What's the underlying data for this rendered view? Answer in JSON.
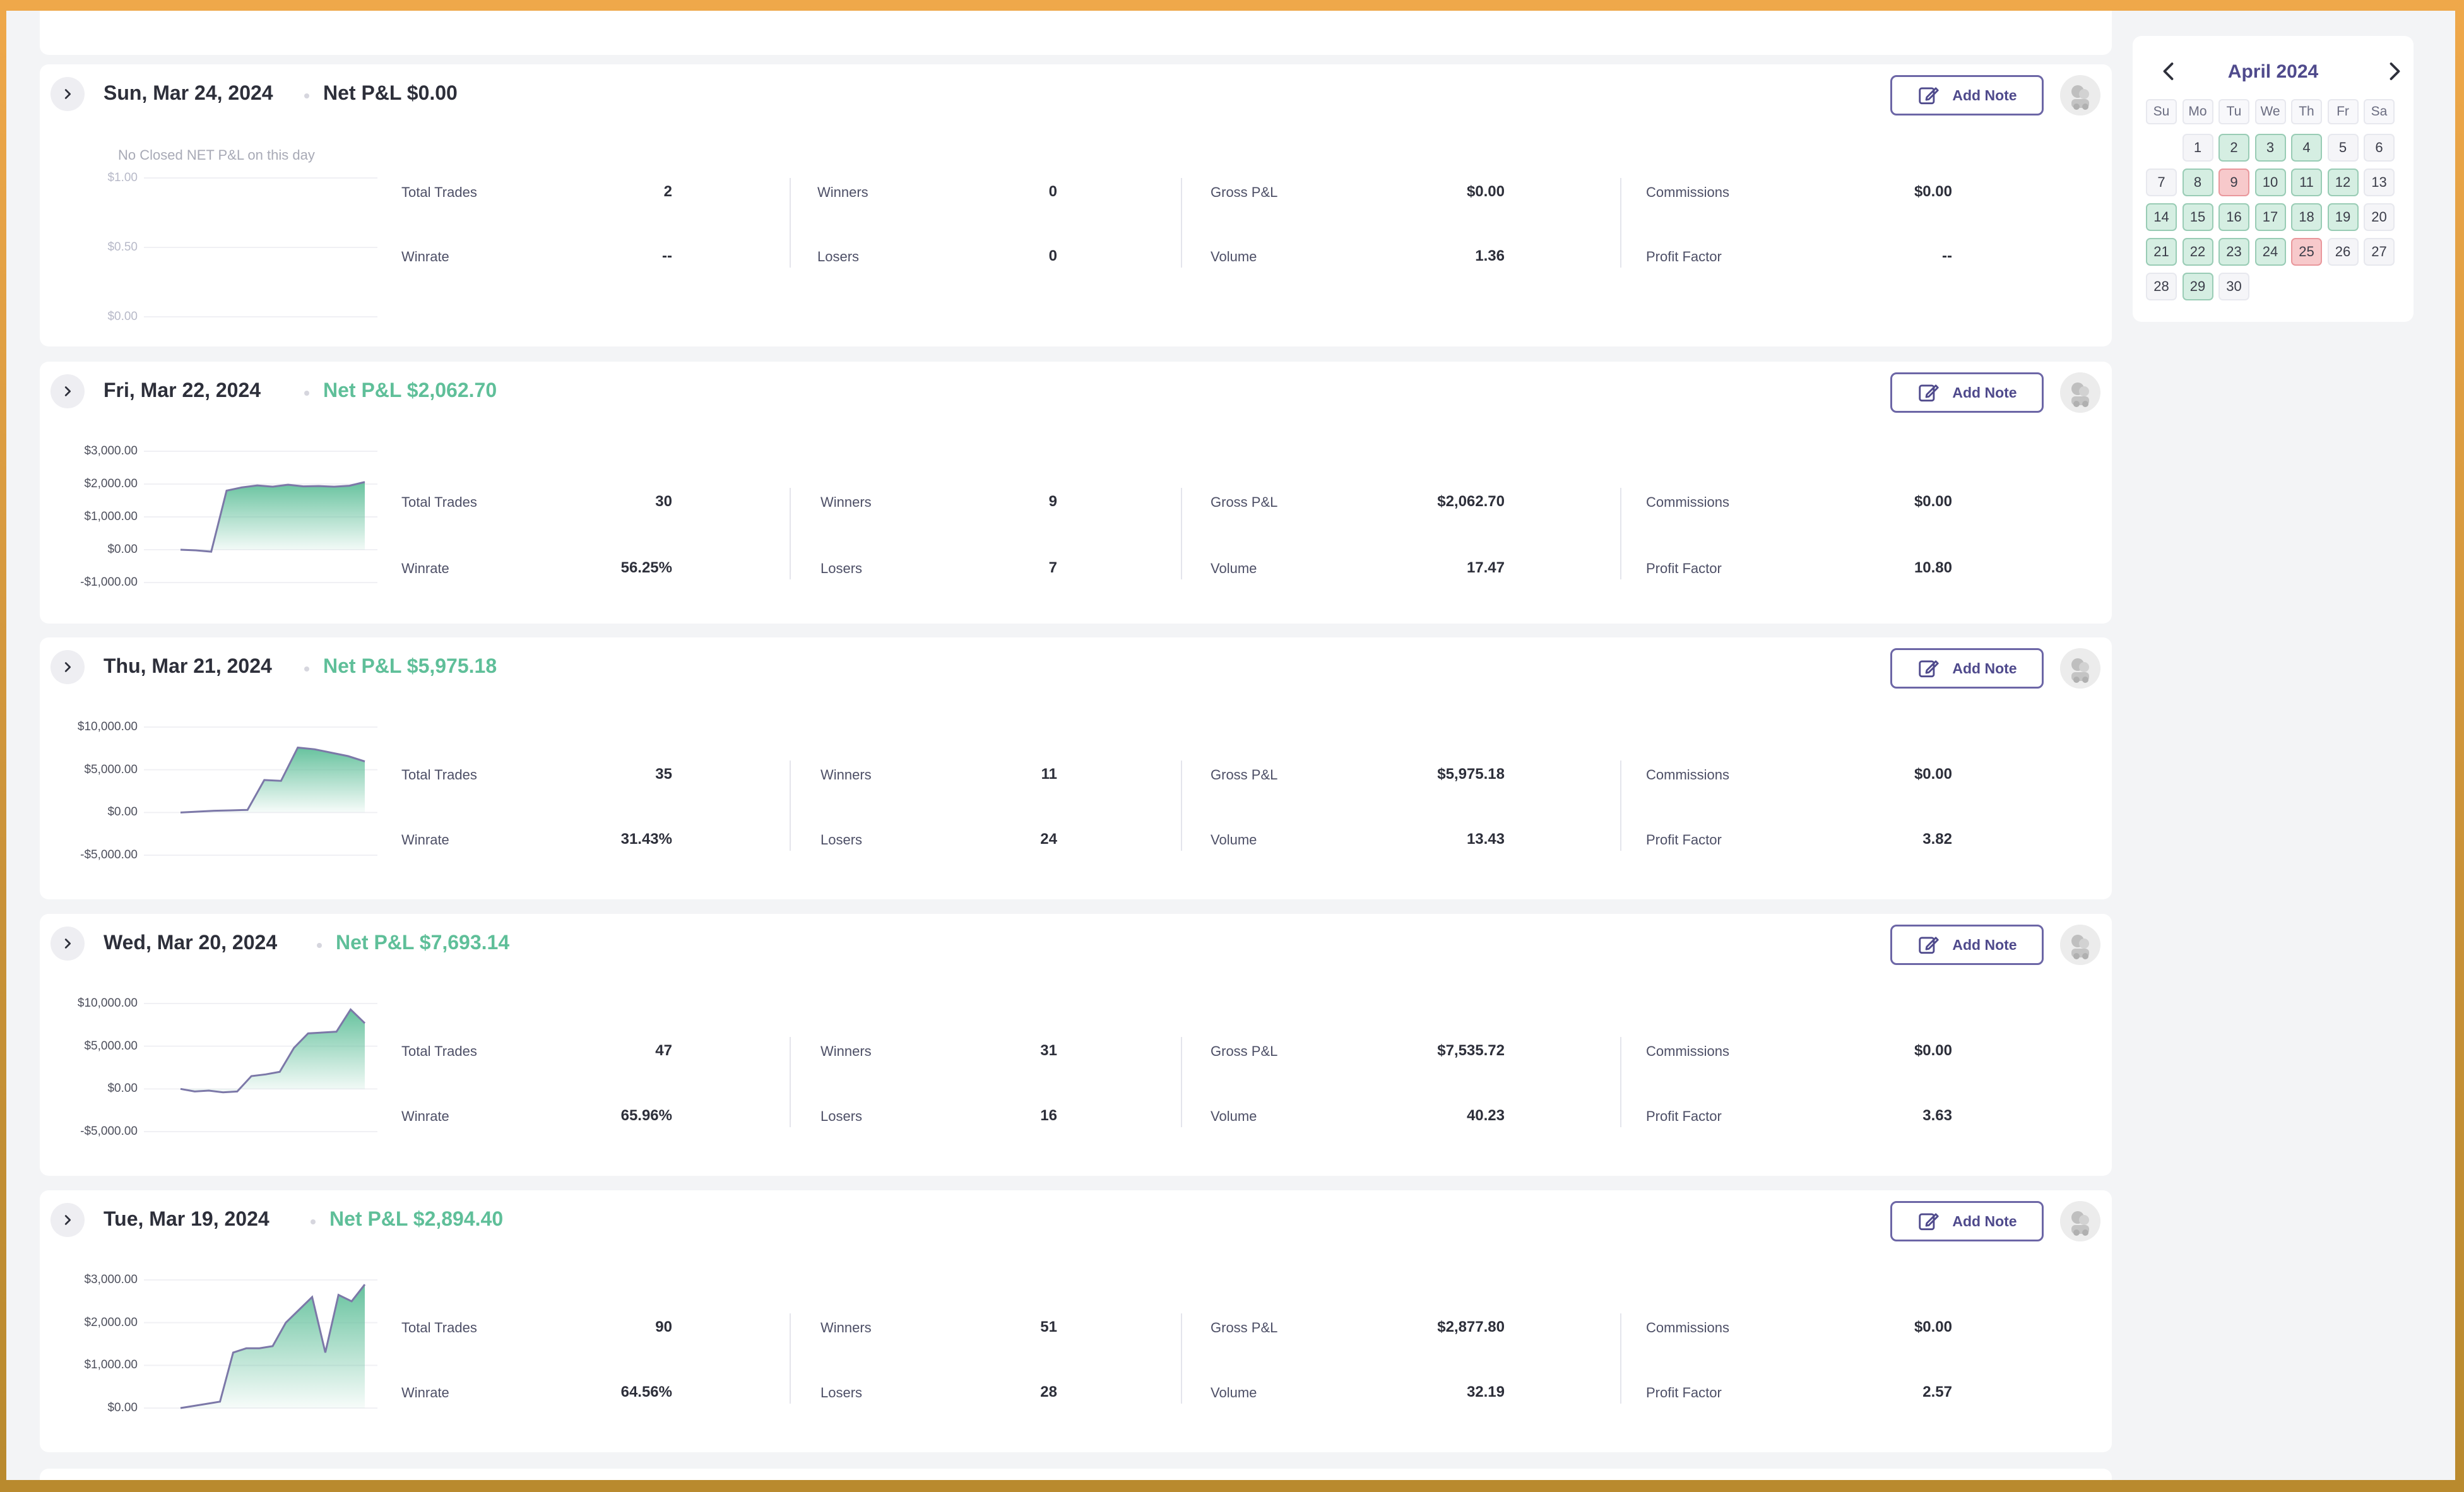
{
  "stat_labels": {
    "total_trades": "Total Trades",
    "winrate": "Winrate",
    "winners": "Winners",
    "losers": "Losers",
    "gross_pnl": "Gross P&L",
    "volume": "Volume",
    "commissions": "Commissions",
    "profit_factor": "Profit Factor"
  },
  "add_note_label": "Add Note",
  "days": [
    {
      "date": "Sun, Mar 24, 2024",
      "net_pnl": "Net P&L $0.00",
      "pnl_color": "#2d2f3a",
      "no_data_text": "No Closed NET P&L on this day",
      "chart_ticks": [
        "$1.00",
        "$0.50",
        "$0.00"
      ],
      "stats": {
        "total_trades": "2",
        "winrate": "--",
        "winners": "0",
        "losers": "0",
        "gross_pnl": "$0.00",
        "volume": "1.36",
        "commissions": "$0.00",
        "profit_factor": "--"
      }
    },
    {
      "date": "Fri, Mar 22, 2024",
      "net_pnl": "Net P&L $2,062.70",
      "pnl_color": "#5fbf99",
      "chart_ticks": [
        "$3,000.00",
        "$2,000.00",
        "$1,000.00",
        "$0.00",
        "-$1,000.00"
      ],
      "chart_data": {
        "type": "area",
        "ylim": [
          -1000,
          3000
        ],
        "y_ticks": [
          "$3,000.00",
          "$2,000.00",
          "$1,000.00",
          "$0.00",
          "-$1,000.00"
        ],
        "values": [
          0,
          -20,
          -60,
          1800,
          1900,
          1960,
          1920,
          1980,
          1930,
          1940,
          1920,
          1950,
          2062.7
        ]
      },
      "stats": {
        "total_trades": "30",
        "winrate": "56.25%",
        "winners": "9",
        "losers": "7",
        "gross_pnl": "$2,062.70",
        "volume": "17.47",
        "commissions": "$0.00",
        "profit_factor": "10.80"
      }
    },
    {
      "date": "Thu, Mar 21, 2024",
      "net_pnl": "Net P&L $5,975.18",
      "pnl_color": "#5fbf99",
      "chart_ticks": [
        "$10,000.00",
        "$5,000.00",
        "$0.00",
        "-$5,000.00"
      ],
      "chart_data": {
        "type": "area",
        "ylim": [
          -5000,
          10000
        ],
        "y_ticks": [
          "$10,000.00",
          "$5,000.00",
          "$0.00",
          "-$5,000.00"
        ],
        "values": [
          0,
          100,
          200,
          250,
          300,
          3800,
          3700,
          7600,
          7400,
          7000,
          6600,
          5975.18
        ]
      },
      "stats": {
        "total_trades": "35",
        "winrate": "31.43%",
        "winners": "11",
        "losers": "24",
        "gross_pnl": "$5,975.18",
        "volume": "13.43",
        "commissions": "$0.00",
        "profit_factor": "3.82"
      }
    },
    {
      "date": "Wed, Mar 20, 2024",
      "net_pnl": "Net P&L $7,693.14",
      "pnl_color": "#5fbf99",
      "chart_ticks": [
        "$10,000.00",
        "$5,000.00",
        "$0.00",
        "-$5,000.00"
      ],
      "chart_data": {
        "type": "area",
        "ylim": [
          -5000,
          10000
        ],
        "y_ticks": [
          "$10,000.00",
          "$5,000.00",
          "$0.00",
          "-$5,000.00"
        ],
        "values": [
          0,
          -300,
          -200,
          -400,
          -300,
          1500,
          1700,
          2000,
          4800,
          6500,
          6600,
          6700,
          9300,
          7693.14
        ]
      },
      "stats": {
        "total_trades": "47",
        "winrate": "65.96%",
        "winners": "31",
        "losers": "16",
        "gross_pnl": "$7,535.72",
        "volume": "40.23",
        "commissions": "$0.00",
        "profit_factor": "3.63"
      }
    },
    {
      "date": "Tue, Mar 19, 2024",
      "net_pnl": "Net P&L $2,894.40",
      "pnl_color": "#5fbf99",
      "chart_ticks": [
        "$3,000.00",
        "$2,000.00",
        "$1,000.00",
        "$0.00"
      ],
      "chart_data": {
        "type": "area",
        "ylim": [
          0,
          3000
        ],
        "y_ticks": [
          "$3,000.00",
          "$2,000.00",
          "$1,000.00",
          "$0.00"
        ],
        "values": [
          0,
          50,
          100,
          150,
          1300,
          1400,
          1400,
          1450,
          2000,
          2300,
          2600,
          1300,
          2650,
          2500,
          2894.4
        ]
      },
      "stats": {
        "total_trades": "90",
        "winrate": "64.56%",
        "winners": "51",
        "losers": "28",
        "gross_pnl": "$2,877.80",
        "volume": "32.19",
        "commissions": "$0.00",
        "profit_factor": "2.57"
      }
    }
  ],
  "calendar": {
    "title": "April 2024",
    "weekdays": [
      "Su",
      "Mo",
      "Tu",
      "We",
      "Th",
      "Fr",
      "Sa"
    ],
    "start_offset": 1,
    "days_in_month": 30,
    "win_days": [
      2,
      3,
      4,
      8,
      10,
      11,
      12,
      14,
      15,
      16,
      17,
      18,
      19,
      21,
      22,
      23,
      24,
      29
    ],
    "loss_days": [
      9,
      25
    ],
    "colors": {
      "win": "#d5eee2",
      "loss": "#f7c9cb",
      "neutral": "#f5f5f8"
    }
  },
  "colors": {
    "positive": "#5fbf99",
    "negative": "#e06b78",
    "accent": "#4f4a8c"
  }
}
